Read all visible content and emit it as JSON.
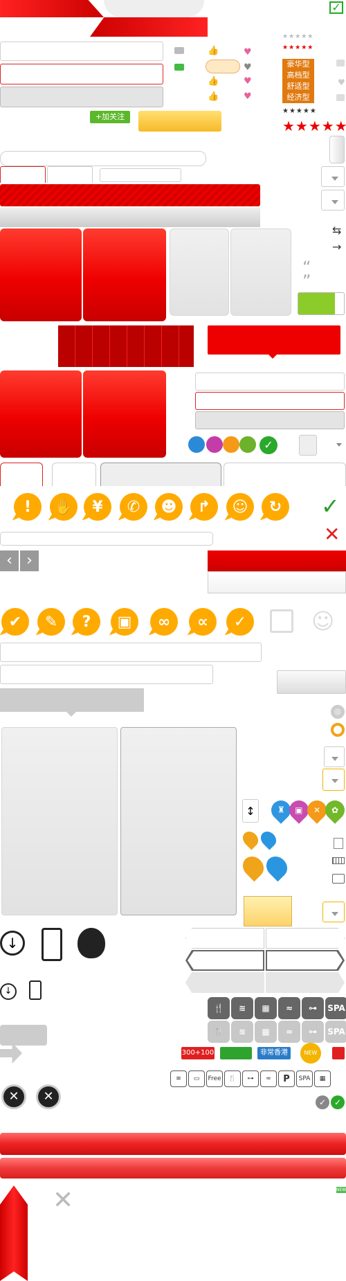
{
  "follow_button": {
    "label": "加关注",
    "plus": "+"
  },
  "hotel_types": [
    "豪华型",
    "高档型",
    "舒适型",
    "经济型"
  ],
  "badges": {
    "price": "300+100",
    "green": "",
    "blue": "非常香港",
    "new": "NEW",
    "tiny_new": "NEW"
  },
  "facility_labels": {
    "spa": "SPA",
    "parking": "P",
    "free": "Free"
  },
  "quotes": {
    "open": "“",
    "close": "”"
  },
  "nav": {
    "prev": "‹",
    "next": "›"
  },
  "arrows": {
    "swap": "⇆",
    "right": "→",
    "sort": "↕"
  },
  "symbols": {
    "check": "✓",
    "cross": "✕",
    "yen": "¥",
    "exclaim": "!",
    "question": "?"
  },
  "colors": {
    "brand_red": "#e00000",
    "orange": "#ffaa00",
    "green": "#2ea44f",
    "gray": "#c8c8c8"
  }
}
